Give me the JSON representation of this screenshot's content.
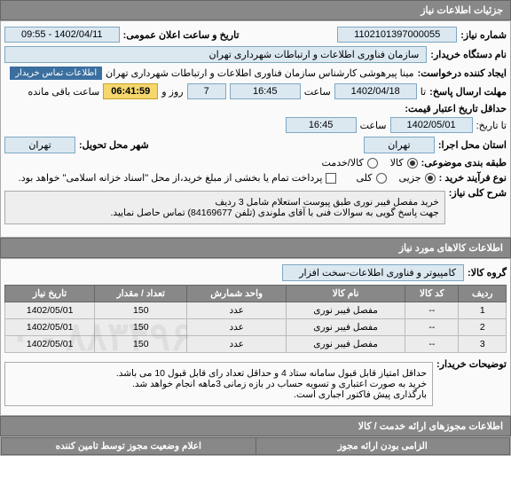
{
  "headers": {
    "need_info": "جزئیات اطلاعات نیاز",
    "goods_info": "اطلاعات کالاهای مورد نیاز",
    "permits_info": "اطلاعات مجوزهای ارائه خدمت / کالا",
    "permit_table": "اعلام وضعیت مجوز توسط تامین کننده",
    "permit_right": "الزامی بودن ارائه مجوز"
  },
  "labels": {
    "need_no": "شماره نیاز:",
    "announce_dt": "تاریخ و ساعت اعلان عمومی:",
    "buyer_org": "نام دستگاه خریدار:",
    "requester": "ایجاد کننده درخواست:",
    "contact": "اطلاعات تماس خریدار",
    "reply_deadline": "مهلت ارسال پاسخ:",
    "to": "تا",
    "hour": "ساعت",
    "and": "روز و",
    "remaining": "ساعت باقی مانده",
    "validity_min": "حداقل تاریخ اعتبار قیمت:",
    "to_date": "تا تاریخ:",
    "exec_province": "استان محل اجرا:",
    "deliver_city": "شهر محل تحویل:",
    "category": "طبقه بندی موضوعی:",
    "process_type": "نوع فرآیند خرید :",
    "partial": "جزیی",
    "full": "کلی",
    "goods": "کالا",
    "service": "کالا/خدمت",
    "payment_note": "پرداخت تمام یا بخشی از مبلغ خرید،از محل \"اسناد خزانه اسلامی\" خواهد بود.",
    "need_title": "شرح کلی نیاز:",
    "goods_group": "گروه کالا:",
    "buyer_notes": "توضیحات خریدار:"
  },
  "values": {
    "need_no": "1102101397000055",
    "announce_dt": "1402/04/11 - 09:55",
    "buyer_org": "سازمان فناوری اطلاعات و ارتباطات شهرداری تهران",
    "requester": "مینا پیرهوشی کارشناس سازمان فناوری اطلاعات و ارتباطات شهرداری تهران",
    "reply_date": "1402/04/18",
    "reply_hour": "16:45",
    "days_left": "7",
    "timer": "06:41:59",
    "validity_date": "1402/05/01",
    "validity_hour": "16:45",
    "province": "تهران",
    "city": "تهران",
    "need_desc": "خرید مفصل فیبر نوری طبق پیوست استعلام شامل 3 ردیف\nجهت پاسخ گویی به سوالات فنی با آقای ملوندی (تلفن 84169677) تماس حاصل نمایید.",
    "goods_group": "کامپیوتر و فناوری اطلاعات-سخت افزار",
    "buyer_notes": "حداقل امتیاز قابل قبول سامانه ستاد 4 و حداقل تعداد رای قابل قبول 10 می باشد.\nخرید به صورت اعتباری و تسویه حساب در بازه زمانی 3ماهه انجام خواهد شد.\nبارگذاری پیش فاکتور اجباری است.",
    "watermark": "۸۸۳۴۹۶ - ۰"
  },
  "table": {
    "cols": {
      "row": "ردیف",
      "code": "کد کالا",
      "name": "نام کالا",
      "unit": "واحد شمارش",
      "qty": "تعداد / مقدار",
      "date": "تاریخ نیاز"
    },
    "rows": [
      {
        "row": "1",
        "code": "--",
        "name": "مفصل فیبر نوری",
        "unit": "عدد",
        "qty": "150",
        "date": "1402/05/01"
      },
      {
        "row": "2",
        "code": "--",
        "name": "مفصل فیبر نوری",
        "unit": "عدد",
        "qty": "150",
        "date": "1402/05/01"
      },
      {
        "row": "3",
        "code": "--",
        "name": "مفصل فیبر نوری",
        "unit": "عدد",
        "qty": "150",
        "date": "1402/05/01"
      }
    ]
  }
}
